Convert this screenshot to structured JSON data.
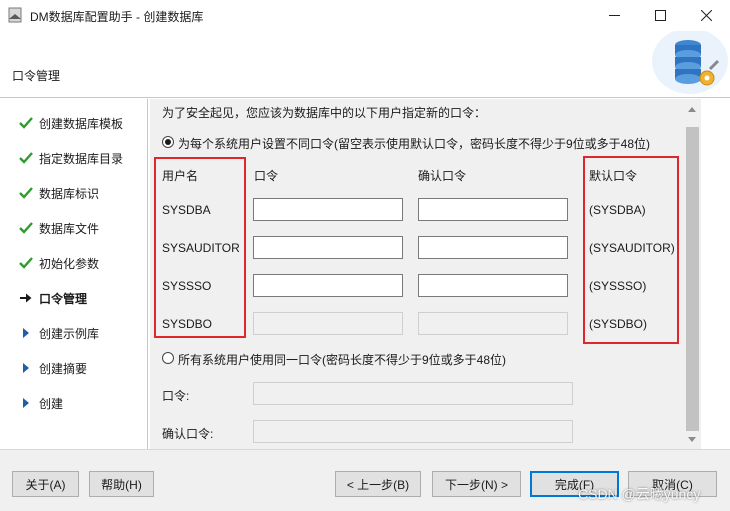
{
  "window": {
    "title": "DM数据库配置助手 - 创建数据库",
    "minimize_glyph": "—",
    "maximize_glyph": "☐",
    "close_glyph": "✕"
  },
  "header": {
    "title": "口令管理",
    "art_icon": "database-gear-icon"
  },
  "sidebar": {
    "steps": [
      {
        "label": "创建数据库模板",
        "state": "done",
        "icon": "checkmark-icon"
      },
      {
        "label": "指定数据库目录",
        "state": "done",
        "icon": "checkmark-icon"
      },
      {
        "label": "数据库标识",
        "state": "done",
        "icon": "checkmark-icon"
      },
      {
        "label": "数据库文件",
        "state": "done",
        "icon": "checkmark-icon"
      },
      {
        "label": "初始化参数",
        "state": "done",
        "icon": "checkmark-icon"
      },
      {
        "label": "口令管理",
        "state": "current",
        "icon": "arrow-right-icon"
      },
      {
        "label": "创建示例库",
        "state": "pending",
        "icon": "triangle-right-icon"
      },
      {
        "label": "创建摘要",
        "state": "pending",
        "icon": "triangle-right-icon"
      },
      {
        "label": "创建",
        "state": "pending",
        "icon": "triangle-right-icon"
      }
    ]
  },
  "main": {
    "intro": "为了安全起见，您应该为数据库中的以下用户指定新的口令：",
    "option_separate": {
      "label": "为每个系统用户设置不同口令(留空表示使用默认口令，密码长度不得少于9位或多于48位)",
      "selected": true
    },
    "columns": {
      "username": "用户名",
      "password": "口令",
      "confirm": "确认口令",
      "default": "默认口令"
    },
    "users": [
      {
        "name": "SYSDBA",
        "password": "",
        "confirm": "",
        "default": "(SYSDBA)",
        "enabled": true
      },
      {
        "name": "SYSAUDITOR",
        "password": "",
        "confirm": "",
        "default": "(SYSAUDITOR)",
        "enabled": true
      },
      {
        "name": "SYSSSO",
        "password": "",
        "confirm": "",
        "default": "(SYSSSO)",
        "enabled": true
      },
      {
        "name": "SYSDBO",
        "password": "",
        "confirm": "",
        "default": "(SYSDBO)",
        "enabled": false
      }
    ],
    "option_same": {
      "label": "所有系统用户使用同一口令(密码长度不得少于9位或多于48位)",
      "selected": false
    },
    "same_password_label": "口令:",
    "same_confirm_label": "确认口令:",
    "same_password_value": "",
    "same_confirm_value": ""
  },
  "footer": {
    "about": "关于(A)",
    "help": "帮助(H)",
    "prev": "< 上一步(B)",
    "next": "下一步(N) >",
    "finish": "完成(F)",
    "cancel": "取消(C)"
  },
  "watermark": "CSDN @云曦yuncy",
  "colors": {
    "highlight_box": "#e0262d",
    "check_green": "#2e9c2e",
    "arrow_blue": "#1f5fa8",
    "primary_border": "#0078d7"
  }
}
